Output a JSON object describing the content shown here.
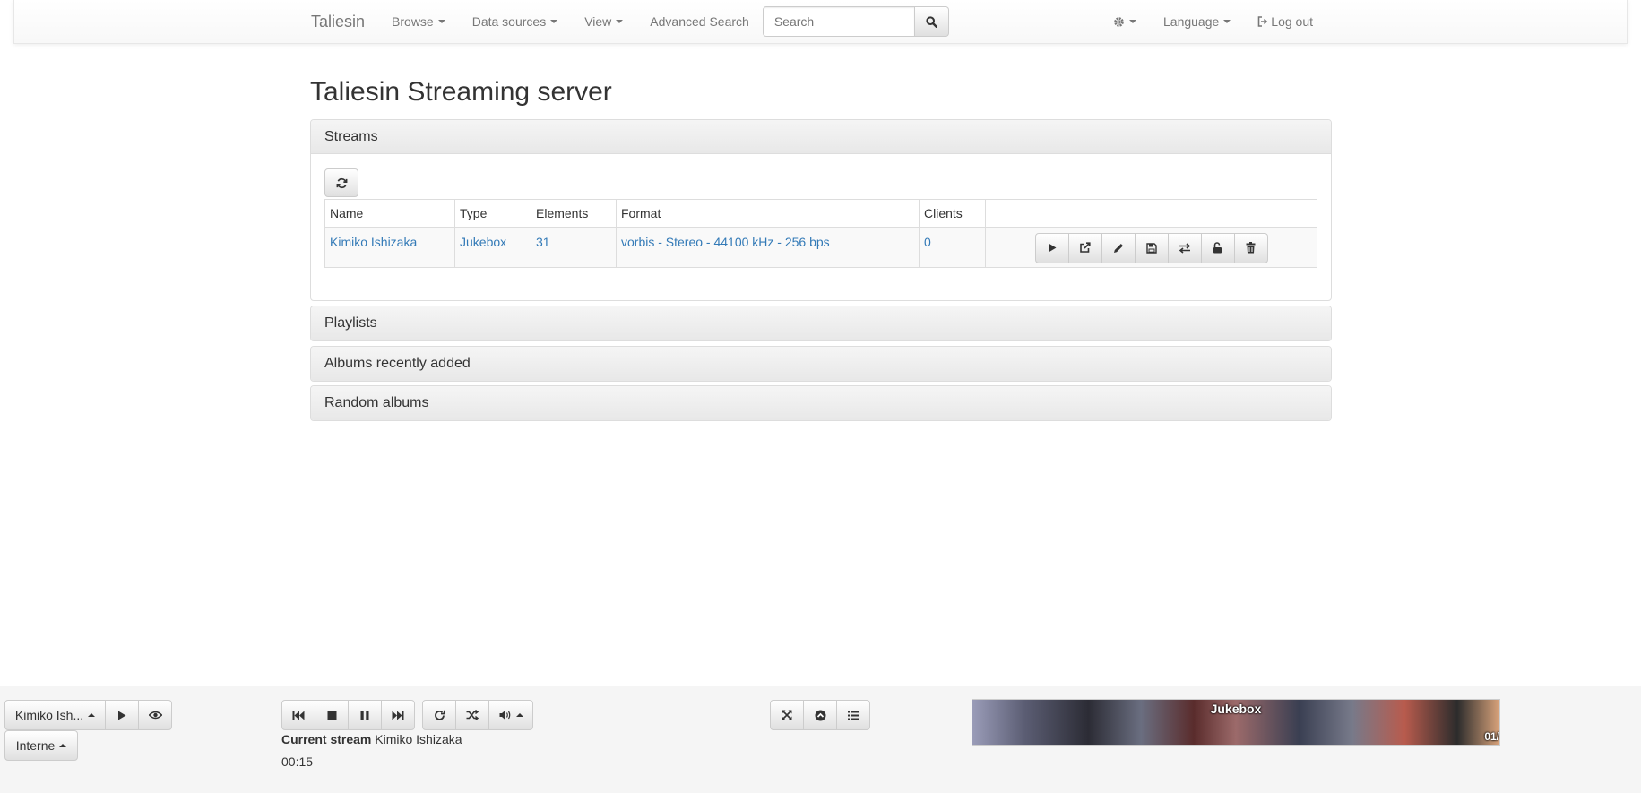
{
  "navbar": {
    "brand": "Taliesin",
    "browse": "Browse",
    "data_sources": "Data sources",
    "view": "View",
    "advanced_search": "Advanced Search",
    "search_placeholder": "Search",
    "language": "Language",
    "logout": "Log out"
  },
  "page": {
    "title": "Taliesin Streaming server"
  },
  "streams_panel": {
    "heading": "Streams",
    "columns": [
      "Name",
      "Type",
      "Elements",
      "Format",
      "Clients",
      ""
    ],
    "rows": [
      {
        "name": "Kimiko Ishizaka",
        "type": "Jukebox",
        "elements": "31",
        "format": "vorbis - Stereo - 44100 kHz - 256 bps",
        "clients": "0"
      }
    ]
  },
  "panels": {
    "playlists": "Playlists",
    "albums_recent": "Albums recently added",
    "random_albums": "Random albums"
  },
  "player": {
    "stream_select": "Kimiko Ish...",
    "output_select": "Interne",
    "current_stream_label": "Current stream",
    "current_stream_value": "Kimiko Ishizaka",
    "time": "00:15",
    "cover_title": "Jukebox",
    "cover_count": "01/"
  },
  "colors": {
    "link": "#337ab7",
    "panel_heading": "#f5f5f5",
    "player_bg": "#f5f5f5"
  }
}
